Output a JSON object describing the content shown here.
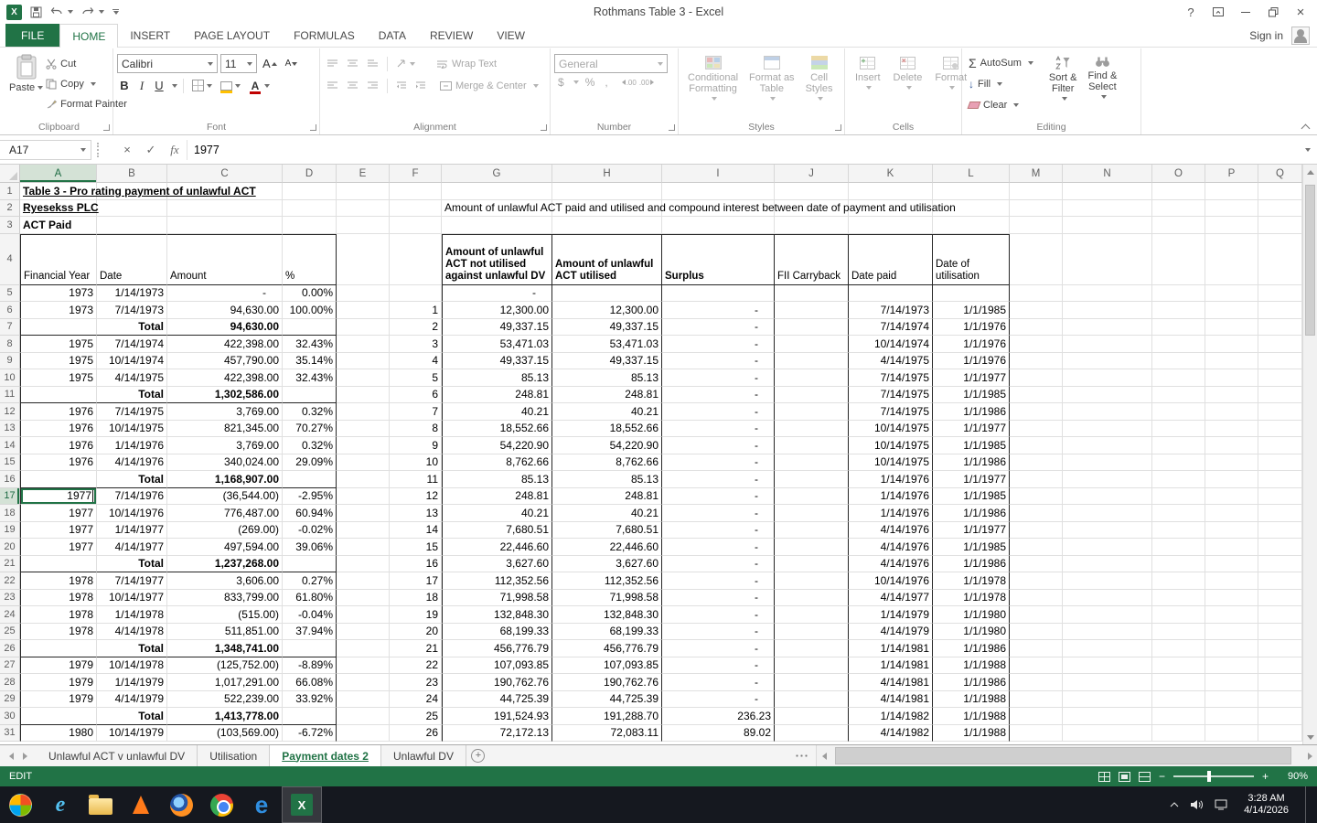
{
  "titlebar": {
    "logo": "X",
    "title": "Rothmans Table 3 - Excel",
    "help": "?",
    "close": "×"
  },
  "ribbon_tabs": {
    "file": "FILE",
    "items": [
      "HOME",
      "INSERT",
      "PAGE LAYOUT",
      "FORMULAS",
      "DATA",
      "REVIEW",
      "VIEW"
    ],
    "active": "HOME",
    "sign_in": "Sign in"
  },
  "ribbon": {
    "clipboard": {
      "group": "Clipboard",
      "paste": "Paste",
      "cut": "Cut",
      "copy": "Copy",
      "format_painter": "Format Painter"
    },
    "font": {
      "group": "Font",
      "name": "Calibri",
      "size": "11",
      "bold": "B",
      "italic": "I",
      "underline": "U",
      "grow": "A",
      "shrink": "A",
      "color": "A"
    },
    "alignment": {
      "group": "Alignment",
      "wrap": "Wrap Text",
      "merge": "Merge & Center"
    },
    "number": {
      "group": "Number",
      "format": "General",
      "currency": "$",
      "percent": "%",
      "comma": ",",
      "inc_dec": ".00",
      "dec_dec": ".00"
    },
    "styles": {
      "group": "Styles",
      "conditional": "Conditional\nFormatting",
      "format_table": "Format as\nTable",
      "cell_styles": "Cell\nStyles"
    },
    "cells": {
      "group": "Cells",
      "insert": "Insert",
      "delete": "Delete",
      "format": "Format"
    },
    "editing": {
      "group": "Editing",
      "sigma": "Σ",
      "autosum": "AutoSum",
      "fill": "Fill",
      "clear": "Clear",
      "sort": "Sort &\nFilter",
      "find": "Find &\nSelect"
    }
  },
  "formula_bar": {
    "name_box": "A17",
    "cancel": "×",
    "accept": "✓",
    "fx": "fx",
    "value": "1977"
  },
  "grid": {
    "selected": {
      "col": "A",
      "row": 17
    },
    "columns": [
      "A",
      "B",
      "C",
      "D",
      "E",
      "F",
      "G",
      "H",
      "I",
      "J",
      "K",
      "L",
      "M",
      "N",
      "O",
      "P",
      "Q"
    ],
    "col_widths": {
      "A": 84,
      "B": 77,
      "C": 126,
      "D": 59,
      "E": 58,
      "F": 57,
      "G": 121,
      "H": 120,
      "I": 123,
      "J": 81,
      "K": 92,
      "L": 84,
      "M": 58,
      "N": 98,
      "O": 58,
      "P": 58,
      "Q": 48
    },
    "total_rows": [
      7,
      11,
      16,
      21,
      26,
      30
    ],
    "rows": [
      {
        "n": 1,
        "cells": {
          "A": "Table 3 - Pro rating payment of unlawful ACT"
        }
      },
      {
        "n": 2,
        "cells": {
          "A": "Ryesekss PLC",
          "G": "Amount of unlawful ACT paid and utilised and compound interest between date of payment and utilisation"
        }
      },
      {
        "n": 3,
        "cells": {
          "A": "ACT Paid"
        }
      },
      {
        "n": 4,
        "cells": {
          "A": "Financial Year",
          "B": "Date",
          "C": "Amount",
          "D": "%",
          "G": "Amount of unlawful\nACT not utilised\nagainst unlawful DV",
          "H": "Amount of unlawful\nACT utilised",
          "I": "Surplus",
          "J": "FII Carryback",
          "K": "Date paid",
          "L": "Date of\nutilisation"
        }
      },
      {
        "n": 5,
        "cells": {
          "A": "1973",
          "B": "1/14/1973",
          "C": "-",
          "D": "0.00%",
          "G": "-"
        }
      },
      {
        "n": 6,
        "cells": {
          "A": "1973",
          "B": "7/14/1973",
          "C": "94,630.00",
          "D": "100.00%",
          "F": "1",
          "G": "12,300.00",
          "H": "12,300.00",
          "I": "-",
          "K": "7/14/1973",
          "L": "1/1/1985"
        }
      },
      {
        "n": 7,
        "cells": {
          "B": "Total",
          "C": "94,630.00",
          "F": "2",
          "G": "49,337.15",
          "H": "49,337.15",
          "I": "-",
          "K": "7/14/1974",
          "L": "1/1/1976"
        }
      },
      {
        "n": 8,
        "cells": {
          "A": "1975",
          "B": "7/14/1974",
          "C": "422,398.00",
          "D": "32.43%",
          "F": "3",
          "G": "53,471.03",
          "H": "53,471.03",
          "I": "-",
          "K": "10/14/1974",
          "L": "1/1/1976"
        }
      },
      {
        "n": 9,
        "cells": {
          "A": "1975",
          "B": "10/14/1974",
          "C": "457,790.00",
          "D": "35.14%",
          "F": "4",
          "G": "49,337.15",
          "H": "49,337.15",
          "I": "-",
          "K": "4/14/1975",
          "L": "1/1/1976"
        }
      },
      {
        "n": 10,
        "cells": {
          "A": "1975",
          "B": "4/14/1975",
          "C": "422,398.00",
          "D": "32.43%",
          "F": "5",
          "G": "85.13",
          "H": "85.13",
          "I": "-",
          "K": "7/14/1975",
          "L": "1/1/1977"
        }
      },
      {
        "n": 11,
        "cells": {
          "B": "Total",
          "C": "1,302,586.00",
          "F": "6",
          "G": "248.81",
          "H": "248.81",
          "I": "-",
          "K": "7/14/1975",
          "L": "1/1/1985"
        }
      },
      {
        "n": 12,
        "cells": {
          "A": "1976",
          "B": "7/14/1975",
          "C": "3,769.00",
          "D": "0.32%",
          "F": "7",
          "G": "40.21",
          "H": "40.21",
          "I": "-",
          "K": "7/14/1975",
          "L": "1/1/1986"
        }
      },
      {
        "n": 13,
        "cells": {
          "A": "1976",
          "B": "10/14/1975",
          "C": "821,345.00",
          "D": "70.27%",
          "F": "8",
          "G": "18,552.66",
          "H": "18,552.66",
          "I": "-",
          "K": "10/14/1975",
          "L": "1/1/1977"
        }
      },
      {
        "n": 14,
        "cells": {
          "A": "1976",
          "B": "1/14/1976",
          "C": "3,769.00",
          "D": "0.32%",
          "F": "9",
          "G": "54,220.90",
          "H": "54,220.90",
          "I": "-",
          "K": "10/14/1975",
          "L": "1/1/1985"
        }
      },
      {
        "n": 15,
        "cells": {
          "A": "1976",
          "B": "4/14/1976",
          "C": "340,024.00",
          "D": "29.09%",
          "F": "10",
          "G": "8,762.66",
          "H": "8,762.66",
          "I": "-",
          "K": "10/14/1975",
          "L": "1/1/1986"
        }
      },
      {
        "n": 16,
        "cells": {
          "B": "Total",
          "C": "1,168,907.00",
          "F": "11",
          "G": "85.13",
          "H": "85.13",
          "I": "-",
          "K": "1/14/1976",
          "L": "1/1/1977"
        }
      },
      {
        "n": 17,
        "cells": {
          "A": "1977",
          "B": "7/14/1976",
          "C": "(36,544.00)",
          "D": "-2.95%",
          "F": "12",
          "G": "248.81",
          "H": "248.81",
          "I": "-",
          "K": "1/14/1976",
          "L": "1/1/1985"
        }
      },
      {
        "n": 18,
        "cells": {
          "A": "1977",
          "B": "10/14/1976",
          "C": "776,487.00",
          "D": "60.94%",
          "F": "13",
          "G": "40.21",
          "H": "40.21",
          "I": "-",
          "K": "1/14/1976",
          "L": "1/1/1986"
        }
      },
      {
        "n": 19,
        "cells": {
          "A": "1977",
          "B": "1/14/1977",
          "C": "(269.00)",
          "D": "-0.02%",
          "F": "14",
          "G": "7,680.51",
          "H": "7,680.51",
          "I": "-",
          "K": "4/14/1976",
          "L": "1/1/1977"
        }
      },
      {
        "n": 20,
        "cells": {
          "A": "1977",
          "B": "4/14/1977",
          "C": "497,594.00",
          "D": "39.06%",
          "F": "15",
          "G": "22,446.60",
          "H": "22,446.60",
          "I": "-",
          "K": "4/14/1976",
          "L": "1/1/1985"
        }
      },
      {
        "n": 21,
        "cells": {
          "B": "Total",
          "C": "1,237,268.00",
          "F": "16",
          "G": "3,627.60",
          "H": "3,627.60",
          "I": "-",
          "K": "4/14/1976",
          "L": "1/1/1986"
        }
      },
      {
        "n": 22,
        "cells": {
          "A": "1978",
          "B": "7/14/1977",
          "C": "3,606.00",
          "D": "0.27%",
          "F": "17",
          "G": "112,352.56",
          "H": "112,352.56",
          "I": "-",
          "K": "10/14/1976",
          "L": "1/1/1978"
        }
      },
      {
        "n": 23,
        "cells": {
          "A": "1978",
          "B": "10/14/1977",
          "C": "833,799.00",
          "D": "61.80%",
          "F": "18",
          "G": "71,998.58",
          "H": "71,998.58",
          "I": "-",
          "K": "4/14/1977",
          "L": "1/1/1978"
        }
      },
      {
        "n": 24,
        "cells": {
          "A": "1978",
          "B": "1/14/1978",
          "C": "(515.00)",
          "D": "-0.04%",
          "F": "19",
          "G": "132,848.30",
          "H": "132,848.30",
          "I": "-",
          "K": "1/14/1979",
          "L": "1/1/1980"
        }
      },
      {
        "n": 25,
        "cells": {
          "A": "1978",
          "B": "4/14/1978",
          "C": "511,851.00",
          "D": "37.94%",
          "F": "20",
          "G": "68,199.33",
          "H": "68,199.33",
          "I": "-",
          "K": "4/14/1979",
          "L": "1/1/1980"
        }
      },
      {
        "n": 26,
        "cells": {
          "B": "Total",
          "C": "1,348,741.00",
          "F": "21",
          "G": "456,776.79",
          "H": "456,776.79",
          "I": "-",
          "K": "1/14/1981",
          "L": "1/1/1986"
        }
      },
      {
        "n": 27,
        "cells": {
          "A": "1979",
          "B": "10/14/1978",
          "C": "(125,752.00)",
          "D": "-8.89%",
          "F": "22",
          "G": "107,093.85",
          "H": "107,093.85",
          "I": "-",
          "K": "1/14/1981",
          "L": "1/1/1988"
        }
      },
      {
        "n": 28,
        "cells": {
          "A": "1979",
          "B": "1/14/1979",
          "C": "1,017,291.00",
          "D": "66.08%",
          "F": "23",
          "G": "190,762.76",
          "H": "190,762.76",
          "I": "-",
          "K": "4/14/1981",
          "L": "1/1/1986"
        }
      },
      {
        "n": 29,
        "cells": {
          "A": "1979",
          "B": "4/14/1979",
          "C": "522,239.00",
          "D": "33.92%",
          "F": "24",
          "G": "44,725.39",
          "H": "44,725.39",
          "I": "-",
          "K": "4/14/1981",
          "L": "1/1/1988"
        }
      },
      {
        "n": 30,
        "cells": {
          "B": "Total",
          "C": "1,413,778.00",
          "F": "25",
          "G": "191,524.93",
          "H": "191,288.70",
          "I": "236.23",
          "K": "1/14/1982",
          "L": "1/1/1988"
        }
      },
      {
        "n": 31,
        "cells": {
          "A": "1980",
          "B": "10/14/1979",
          "C": "(103,569.00)",
          "D": "-6.72%",
          "F": "26",
          "G": "72,172.13",
          "H": "72,083.11",
          "I": "89.02",
          "K": "4/14/1982",
          "L": "1/1/1988"
        }
      }
    ]
  },
  "sheet_bar": {
    "tabs": [
      "Unlawful ACT v unlawful DV",
      "Utilisation",
      "Payment dates 2",
      "Unlawful DV"
    ],
    "active": "Payment dates 2",
    "new_sheet": "+"
  },
  "status_bar": {
    "mode": "EDIT",
    "zoom": "90%",
    "zoom_minus": "−",
    "zoom_plus": "+"
  },
  "taskbar": {
    "ie": "e",
    "edge": "e",
    "excel": "X",
    "time": "3:28 AM",
    "date": "4/14/2026"
  }
}
